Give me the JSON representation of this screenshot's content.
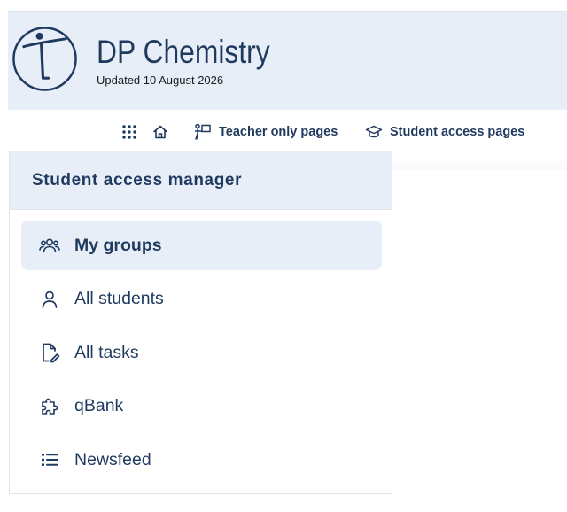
{
  "header": {
    "logo_icon": "figure-in-circle-logo",
    "title": "DP Chemistry",
    "updated": "Updated 10 August 2026"
  },
  "topnav": {
    "items": [
      {
        "icon": "grid-icon",
        "label": ""
      },
      {
        "icon": "home-icon",
        "label": ""
      },
      {
        "icon": "teacher-board-icon",
        "label": "Teacher only pages"
      },
      {
        "icon": "graduation-cap-icon",
        "label": "Student access pages"
      }
    ]
  },
  "panel": {
    "title": "Student access manager",
    "items": [
      {
        "icon": "users-icon",
        "label": "My groups",
        "active": true
      },
      {
        "icon": "user-icon",
        "label": "All students",
        "active": false
      },
      {
        "icon": "file-edit-icon",
        "label": "All tasks",
        "active": false
      },
      {
        "icon": "puzzle-icon",
        "label": "qBank",
        "active": false
      },
      {
        "icon": "list-icon",
        "label": "Newsfeed",
        "active": false
      }
    ]
  },
  "colors": {
    "primary": "#1f3a5f",
    "header_bg": "#e8eef7",
    "border": "#dfe4ea"
  }
}
